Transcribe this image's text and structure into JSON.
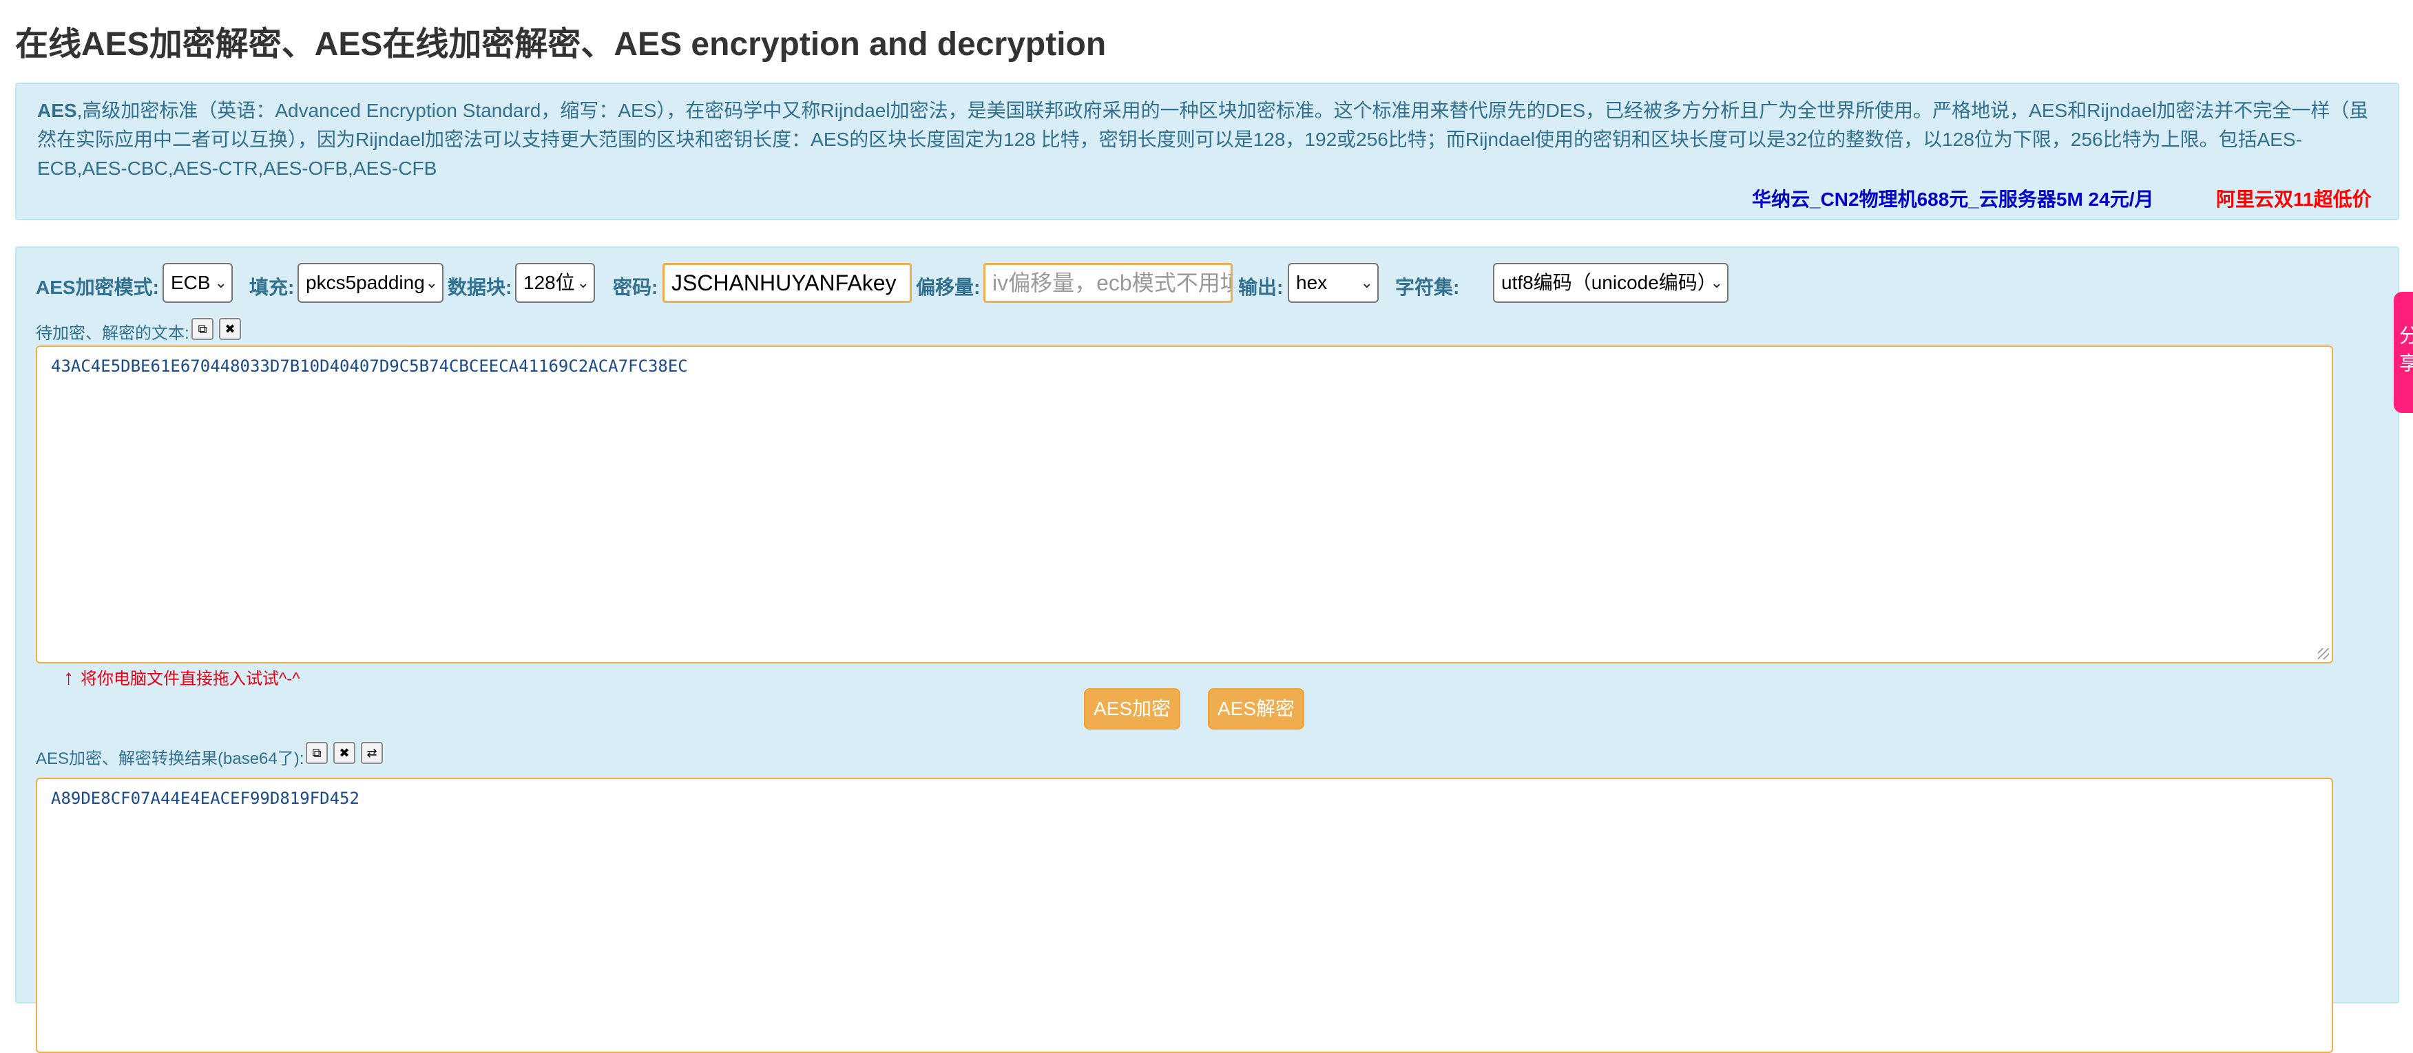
{
  "page": {
    "title": "在线AES加密解密、AES在线加密解密、AES encryption and decryption"
  },
  "intro": {
    "lead": "AES",
    "text": ",高级加密标准（英语：Advanced Encryption Standard，缩写：AES），在密码学中又称Rijndael加密法，是美国联邦政府采用的一种区块加密标准。这个标准用来替代原先的DES，已经被多方分析且广为全世界所使用。严格地说，AES和Rijndael加密法并不完全一样（虽然在实际应用中二者可以互换），因为Rijndael加密法可以支持更大范围的区块和密钥长度：AES的区块长度固定为128 比特，密钥长度则可以是128，192或256比特；而Rijndael使用的密钥和区块长度可以是32位的整数倍，以128位为下限，256比特为上限。包括AES-ECB,AES-CBC,AES-CTR,AES-OFB,AES-CFB",
    "promo_1": "华纳云_CN2物理机688元_云服务器5M 24元/月",
    "promo_2": "阿里云双11超低价",
    "promo_1_color": "#0000cc",
    "promo_2_color": "#ff0000"
  },
  "options": {
    "mode_label": "AES加密模式:",
    "mode_value": "ECB",
    "padding_label": "填充:",
    "padding_value": "pkcs5padding",
    "block_label": "数据块:",
    "block_value": "128位",
    "key_label": "密码:",
    "key_value": "JSCHANHUYANFAkey",
    "iv_label": "偏移量:",
    "iv_placeholder": "iv偏移量，ecb模式不用填写！",
    "output_label": "输出:",
    "output_value": "hex",
    "charset_label": "字符集:",
    "charset_value": "utf8编码（unicode编码）"
  },
  "input": {
    "label": "待加密、解密的文本:",
    "text": "43AC4E5DBE61E670448033D7B10D40407D9C5B74CBCEECA41169C2ACA7FC38EC",
    "hint": "将你电脑文件直接拖入试试^-^",
    "hint_arrow": "↑"
  },
  "actions": {
    "encrypt": "AES加密",
    "decrypt": "AES解密"
  },
  "output": {
    "label": "AES加密、解密转换结果(base64了):",
    "text": "A89DE8CF07A44E4EACEF99D819FD452"
  },
  "side_tab": {
    "text": "分享"
  },
  "icons": {
    "copy": "⧉",
    "clear": "✖",
    "swap": "⇄",
    "chevron": "⌄"
  },
  "colors": {
    "panel_bg": "#d9edf7",
    "accent": "#f0ad4e",
    "label": "#31708f"
  }
}
